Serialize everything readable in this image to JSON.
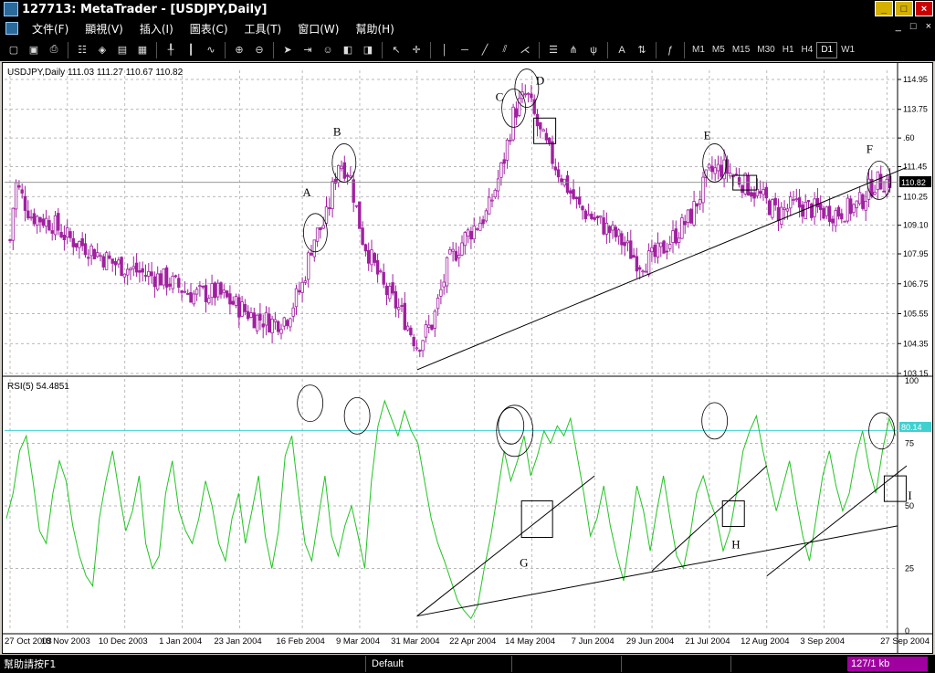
{
  "window": {
    "title": "127713: MetaTrader - [USDJPY,Daily]",
    "min": "_",
    "max": "□",
    "close": "×"
  },
  "menu": {
    "items": [
      "文件(F)",
      "顯視(V)",
      "插入(I)",
      "圖表(C)",
      "工具(T)",
      "窗口(W)",
      "幫助(H)"
    ],
    "right_min": "_",
    "right_restore": "□",
    "right_close": "×"
  },
  "toolbar": {
    "timeframes": [
      "M1",
      "M5",
      "M15",
      "M30",
      "H1",
      "H4",
      "D1",
      "W1"
    ],
    "active_timeframe": "D1",
    "text_tool": "A"
  },
  "chart": {
    "price_header": "USDJPY,Daily  111.03 111.27 110.67 110.82",
    "rsi_header": "RSI(5)  54.4851",
    "current_price": "110.82",
    "rsi_level_label": "80.14"
  },
  "chart_data": [
    {
      "type": "candlestick",
      "symbol": "USDJPY",
      "timeframe": "Daily",
      "ohlc_last": {
        "open": 111.03,
        "high": 111.27,
        "low": 110.67,
        "close": 110.82
      },
      "y_ticks": [
        "114.95",
        "113.75",
        "112.60",
        "111.45",
        "110.25",
        "109.10",
        "107.95",
        "106.75",
        "105.55",
        "104.35",
        "103.15"
      ],
      "y_tick_labels": [
        "114.95",
        "113.75",
        ".60",
        "111.45",
        "110.25",
        "109.10",
        "107.95",
        "106.75",
        "105.55",
        "104.35",
        "103.15"
      ],
      "ylim": [
        103.15,
        114.95
      ],
      "x_labels": [
        "27 Oct 2003",
        "18 Nov 2003",
        "10 Dec 2003",
        "1 Jan 2004",
        "23 Jan 2004",
        "16 Feb 2004",
        "9 Mar 2004",
        "31 Mar 2004",
        "22 Apr 2004",
        "14 May 2004",
        "7 Jun 2004",
        "29 Jun 2004",
        "21 Jul 2004",
        "12 Aug 2004",
        "3 Sep 2004",
        "27 Sep 2004"
      ],
      "path_points": [
        [
          "27 Oct 2003",
          108.5
        ],
        [
          "29 Oct 2003",
          110.8
        ],
        [
          "4 Nov 2003",
          109.5
        ],
        [
          "12 Nov 2003",
          109.2
        ],
        [
          "18 Nov 2003",
          108.6
        ],
        [
          "26 Nov 2003",
          108.2
        ],
        [
          "5 Dec 2003",
          107.6
        ],
        [
          "16 Dec 2003",
          107.2
        ],
        [
          "26 Dec 2003",
          106.9
        ],
        [
          "5 Jan 2004",
          106.3
        ],
        [
          "14 Jan 2004",
          106.4
        ],
        [
          "23 Jan 2004",
          105.8
        ],
        [
          "29 Jan 2004",
          105.4
        ],
        [
          "5 Feb 2004",
          105.2
        ],
        [
          "10 Feb 2004",
          105.4
        ],
        [
          "16 Feb 2004",
          106.7
        ],
        [
          "20 Feb 2004",
          108.5
        ],
        [
          "25 Feb 2004",
          109.3
        ],
        [
          "1 Mar 2004",
          111.7
        ],
        [
          "5 Mar 2004",
          111.2
        ],
        [
          "10 Mar 2004",
          108.6
        ],
        [
          "18 Mar 2004",
          106.6
        ],
        [
          "25 Mar 2004",
          105.6
        ],
        [
          "31 Mar 2004",
          104.3
        ],
        [
          "6 Apr 2004",
          105.2
        ],
        [
          "12 Apr 2004",
          107.6
        ],
        [
          "19 Apr 2004",
          108.7
        ],
        [
          "27 Apr 2004",
          109.6
        ],
        [
          "3 May 2004",
          111.6
        ],
        [
          "7 May 2004",
          113.6
        ],
        [
          "12 May 2004",
          114.4
        ],
        [
          "17 May 2004",
          112.8
        ],
        [
          "24 May 2004",
          111.3
        ],
        [
          "1 Jun 2004",
          109.8
        ],
        [
          "9 Jun 2004",
          109.2
        ],
        [
          "17 Jun 2004",
          108.5
        ],
        [
          "24 Jun 2004",
          107.6
        ],
        [
          "30 Jun 2004",
          107.8
        ],
        [
          "7 Jul 2004",
          108.6
        ],
        [
          "14 Jul 2004",
          109.5
        ],
        [
          "21 Jul 2004",
          111.2
        ],
        [
          "26 Jul 2004",
          111.4
        ],
        [
          "2 Aug 2004",
          110.9
        ],
        [
          "9 Aug 2004",
          110.3
        ],
        [
          "16 Aug 2004",
          109.6
        ],
        [
          "23 Aug 2004",
          109.9
        ],
        [
          "31 Aug 2004",
          109.7
        ],
        [
          "8 Sep 2004",
          109.6
        ],
        [
          "16 Sep 2004",
          109.9
        ],
        [
          "22 Sep 2004",
          110.8
        ],
        [
          "29 Sep 2004",
          110.9
        ]
      ],
      "annotations": [
        "A",
        "B",
        "C",
        "D",
        "E",
        "F"
      ],
      "trendline": [
        [
          "31 Mar 2004",
          103.3
        ],
        [
          "29 Sep 2004",
          111.2
        ]
      ]
    },
    {
      "type": "line",
      "indicator": "RSI(5)",
      "last_value": 54.4851,
      "ylim": [
        0,
        100
      ],
      "y_ticks": [
        100,
        75,
        50,
        25,
        0
      ],
      "y_tick_labels": [
        "100",
        "75",
        "50",
        "25",
        "0"
      ],
      "level": 80.14,
      "series": [
        {
          "values": [
            45,
            55,
            72,
            78,
            60,
            40,
            35,
            55,
            68,
            60,
            42,
            30,
            22,
            18,
            45,
            60,
            72,
            55,
            40,
            48,
            62,
            35,
            25,
            30,
            55,
            68,
            48,
            40,
            35,
            45,
            60,
            50,
            35,
            28,
            45,
            55,
            35,
            48,
            62,
            38,
            25,
            40,
            70,
            78,
            55,
            35,
            28,
            45,
            62,
            38,
            30,
            42,
            50,
            38,
            25,
            60,
            82,
            92,
            85,
            78,
            88,
            80,
            75,
            60,
            45,
            35,
            28,
            20,
            12,
            8,
            5,
            10,
            25,
            38,
            55,
            72,
            60,
            68,
            78,
            62,
            70,
            80,
            75,
            82,
            78,
            85,
            70,
            55,
            38,
            45,
            58,
            42,
            30,
            20,
            38,
            58,
            48,
            32,
            48,
            62,
            45,
            30,
            25,
            38,
            55,
            62,
            52,
            45,
            32,
            40,
            55,
            72,
            80,
            86,
            72,
            60,
            48,
            58,
            68,
            52,
            38,
            28,
            45,
            62,
            72,
            58,
            48,
            55,
            70,
            80,
            65,
            55,
            72,
            85,
            78
          ]
        }
      ],
      "annotations": [
        "G",
        "H",
        "I"
      ]
    }
  ],
  "statusbar": {
    "help": "幫助請按F1",
    "profile": "Default",
    "connection": "127/1 kb"
  },
  "colors": {
    "candle": "#a020a0",
    "rsi": "#22c422",
    "level": "#40d0d0",
    "grid": "#a0a0a0",
    "current_price_bg": "#000000"
  }
}
